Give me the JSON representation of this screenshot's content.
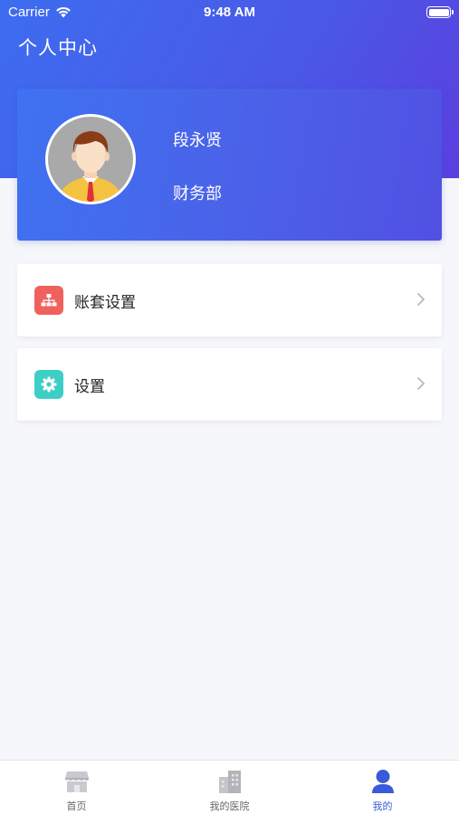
{
  "status_bar": {
    "carrier": "Carrier",
    "time": "9:48 AM"
  },
  "header": {
    "title": "个人中心"
  },
  "profile": {
    "name": "段永贤",
    "department": "财务部"
  },
  "menu": [
    {
      "label": "账套设置",
      "icon": "org-chart-icon",
      "icon_color": "#f0605d"
    },
    {
      "label": "设置",
      "icon": "gear-icon",
      "icon_color": "#3dcfc6"
    }
  ],
  "tabs": [
    {
      "label": "首页",
      "icon": "store-icon",
      "active": false
    },
    {
      "label": "我的医院",
      "icon": "hospital-building-icon",
      "active": false
    },
    {
      "label": "我的",
      "icon": "person-icon",
      "active": true
    }
  ],
  "colors": {
    "accent": "#3a5bd9",
    "header_start": "#3d6df0",
    "header_end": "#5b3fe0"
  }
}
